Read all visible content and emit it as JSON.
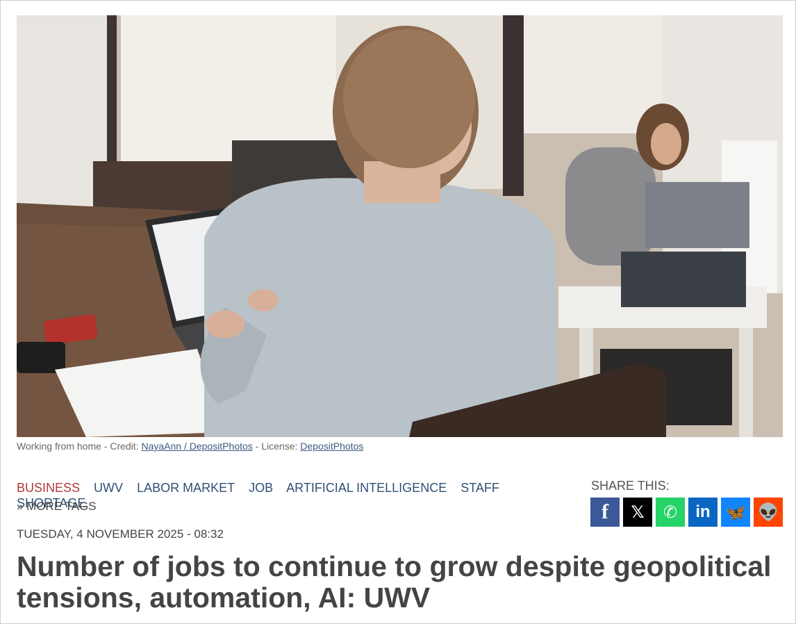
{
  "photo": {
    "alt": "Woman working on a laptop at a wooden table, another woman with a laptop in the background"
  },
  "caption": {
    "prefix": "Working from home - Credit: ",
    "credit_link": "NayaAnn / DepositPhotos",
    "middle": " - License: ",
    "license_link": "DepositPhotos"
  },
  "tags": [
    {
      "label": "BUSINESS",
      "active": true
    },
    {
      "label": "UWV"
    },
    {
      "label": "LABOR MARKET"
    },
    {
      "label": "JOB"
    },
    {
      "label": "ARTIFICIAL INTELLIGENCE"
    },
    {
      "label": "STAFF SHORTAGE"
    }
  ],
  "more_tags": "» MORE TAGS",
  "date": "TUESDAY, 4 NOVEMBER 2025 - 08:32",
  "headline": "Number of jobs to continue to grow despite geopolitical tensions, automation, AI: UWV",
  "share": {
    "label": "SHARE THIS:",
    "buttons": [
      {
        "name": "facebook",
        "glyph": "f",
        "color": "#3b5998"
      },
      {
        "name": "x",
        "glyph": "𝕏",
        "color": "#000000"
      },
      {
        "name": "whatsapp",
        "glyph": "✆",
        "color": "#25d366"
      },
      {
        "name": "linkedin",
        "glyph": "in",
        "color": "#0a66c2"
      },
      {
        "name": "bluesky",
        "glyph": "🦋",
        "color": "#1185fe"
      },
      {
        "name": "reddit",
        "glyph": "👽",
        "color": "#ff4500"
      }
    ]
  }
}
